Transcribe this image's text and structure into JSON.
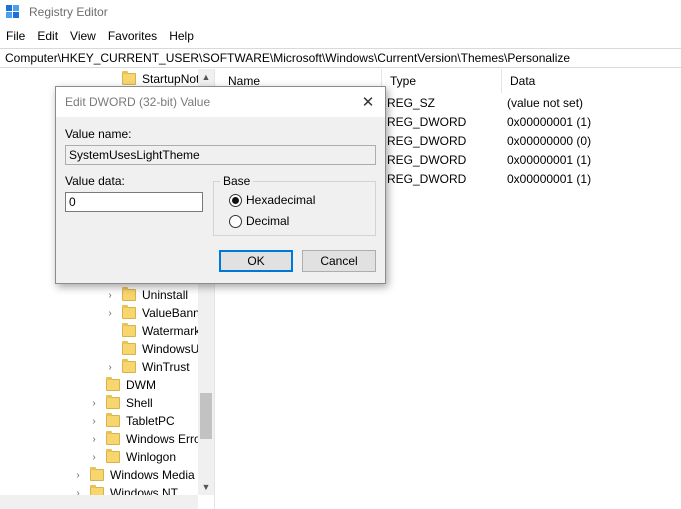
{
  "window": {
    "title": "Registry Editor"
  },
  "menu": [
    "File",
    "Edit",
    "View",
    "Favorites",
    "Help"
  ],
  "address": "Computer\\HKEY_CURRENT_USER\\SOFTWARE\\Microsoft\\Windows\\CurrentVersion\\Themes\\Personalize",
  "tree": {
    "items": [
      {
        "label": "StartupNot",
        "expandable": false
      },
      {
        "label": "Uninstall",
        "expandable": true
      },
      {
        "label": "ValueBanne",
        "expandable": true
      },
      {
        "label": "Watermark",
        "expandable": false
      },
      {
        "label": "WindowsUp",
        "expandable": false
      },
      {
        "label": "WinTrust",
        "expandable": true
      },
      {
        "label": "DWM",
        "expandable": false
      },
      {
        "label": "Shell",
        "expandable": true
      },
      {
        "label": "TabletPC",
        "expandable": true
      },
      {
        "label": "Windows Error",
        "expandable": true
      },
      {
        "label": "Winlogon",
        "expandable": true
      },
      {
        "label": "Windows Media",
        "expandable": true
      },
      {
        "label": "Windows NT",
        "expandable": true
      }
    ]
  },
  "list": {
    "columns": {
      "name": "Name",
      "type": "Type",
      "data": "Data"
    },
    "rows": [
      {
        "type": "REG_SZ",
        "data": "(value not set)"
      },
      {
        "type": "REG_DWORD",
        "data": "0x00000001 (1)"
      },
      {
        "type": "REG_DWORD",
        "data": "0x00000000 (0)"
      },
      {
        "type": "REG_DWORD",
        "data": "0x00000001 (1)"
      },
      {
        "type": "REG_DWORD",
        "data": "0x00000001 (1)"
      }
    ]
  },
  "dialog": {
    "title": "Edit DWORD (32-bit) Value",
    "value_name_label": "Value name:",
    "value_name": "SystemUsesLightTheme",
    "value_data_label": "Value data:",
    "value_data": "0",
    "base_label": "Base",
    "hex_label": "Hexadecimal",
    "dec_label": "Decimal",
    "ok_label": "OK",
    "cancel_label": "Cancel",
    "close_glyph": "✕"
  },
  "icons": {
    "chevron": "›",
    "scroll_up": "▲",
    "scroll_down": "▼"
  }
}
